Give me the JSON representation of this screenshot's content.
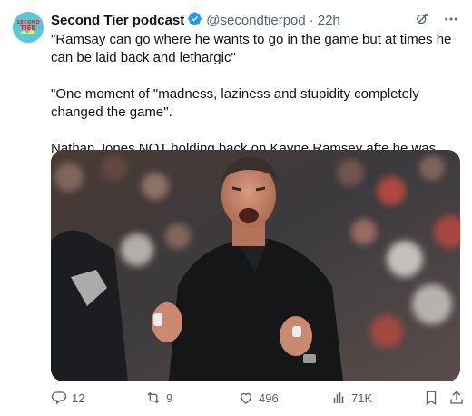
{
  "author": {
    "name": "Second Tier podcast",
    "handle": "@secondtierpod",
    "separator": "·",
    "time": "22h",
    "avatar_text": "SECOND TIER"
  },
  "tweet": {
    "paragraphs": [
      "\"Ramsay can go where he wants to go in the game but at times he can be laid back and lethargic\"",
      "\"One moment of \"madness, laziness and stupidity completely changed the game\".",
      "Nathan Jones NOT holding back on Kayne Ramsey afte he was sent off 😳"
    ]
  },
  "actions": {
    "replies": "12",
    "reposts": "9",
    "likes": "496",
    "views": "71K"
  },
  "icons": {
    "verified": "verified-badge-icon",
    "grok": "grok-icon",
    "more": "more-icon",
    "reply": "reply-icon",
    "repost": "repost-icon",
    "like": "heart-icon",
    "views": "views-icon",
    "bookmark": "bookmark-icon",
    "share": "share-icon"
  },
  "colors": {
    "text": "#0f1419",
    "secondary": "#536471",
    "verified": "#1d9bf0",
    "avatar_bg": "#5bc7d6"
  }
}
